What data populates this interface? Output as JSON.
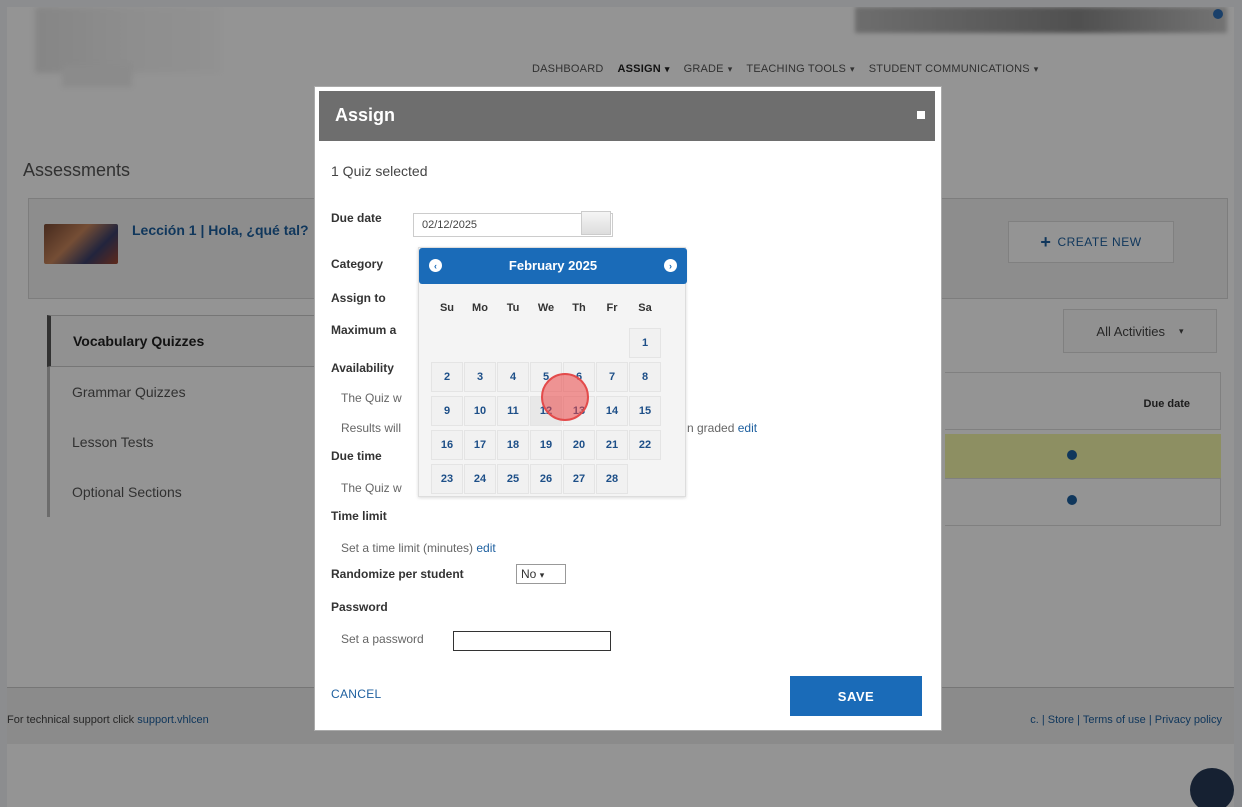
{
  "nav": {
    "items": [
      {
        "label": "DASHBOARD",
        "active": false,
        "dropdown": false
      },
      {
        "label": "ASSIGN",
        "active": true,
        "dropdown": true
      },
      {
        "label": "GRADE",
        "active": false,
        "dropdown": true
      },
      {
        "label": "TEACHING TOOLS",
        "active": false,
        "dropdown": true
      },
      {
        "label": "STUDENT COMMUNICATIONS",
        "active": false,
        "dropdown": true
      }
    ]
  },
  "page": {
    "title": "Assessments",
    "lesson": "Lección 1 | Hola, ¿qué tal?",
    "create_new": "CREATE NEW",
    "filter": "All Activities",
    "due_date_header": "Due date",
    "tabs": [
      "Vocabulary Quizzes",
      "Grammar Quizzes",
      "Lesson Tests",
      "Optional Sections"
    ],
    "active_tab": "Vocabulary Quizzes"
  },
  "footer": {
    "support_text": "For technical support click",
    "support_link": "support.vhlcen",
    "right_text": "c. | Store | Terms of use | Privacy policy"
  },
  "modal": {
    "title": "Assign",
    "selected": "1 Quiz selected",
    "due_date_label": "Due date",
    "due_date_value": "02/12/2025",
    "category_label": "Category",
    "assign_to_label": "Assign to",
    "maximum_label": "Maximum a",
    "availability_label": "Availability",
    "availability_text": "The Quiz w",
    "results_text": "Results will",
    "results_suffix": "n graded",
    "results_edit": "edit",
    "due_time_label": "Due time",
    "due_time_text": "The Quiz w",
    "time_limit_label": "Time limit",
    "time_limit_text": "Set a time limit (minutes)",
    "time_limit_edit": "edit",
    "randomize_label": "Randomize per student",
    "randomize_value": "No",
    "password_label": "Password",
    "password_text": "Set a password",
    "cancel": "CANCEL",
    "save": "SAVE"
  },
  "datepicker": {
    "month_label": "February 2025",
    "weekdays": [
      "Su",
      "Mo",
      "Tu",
      "We",
      "Th",
      "Fr",
      "Sa"
    ],
    "days": [
      "1",
      "2",
      "3",
      "4",
      "5",
      "6",
      "7",
      "8",
      "9",
      "10",
      "11",
      "12",
      "13",
      "14",
      "15",
      "16",
      "17",
      "18",
      "19",
      "20",
      "21",
      "22",
      "23",
      "24",
      "25",
      "26",
      "27",
      "28"
    ],
    "selected_day": "12",
    "first_weekday_index": 6
  }
}
